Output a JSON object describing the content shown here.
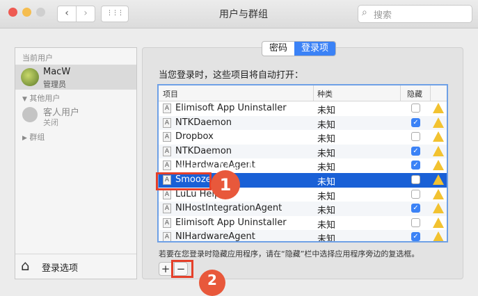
{
  "window": {
    "title": "用户与群组",
    "search_placeholder": "搜索",
    "nav_back": "‹",
    "nav_forward": "›",
    "grid": "⋮⋮⋮"
  },
  "colors": {
    "accent": "#1960d6",
    "close": "#ee5a52",
    "minimize": "#f5bd4f",
    "zoom": "#cfcfcf",
    "annotation": "#e5402a"
  },
  "sidebar": {
    "current_users_label": "当前用户",
    "current_user": {
      "name": "MacW",
      "role": "管理员"
    },
    "other_users_label": "其他用户",
    "guest_user": {
      "name": "客人用户",
      "status": "关闭"
    },
    "groups_label": "群组",
    "login_options": "登录选项"
  },
  "tabs": [
    {
      "label": "密码"
    },
    {
      "label": "登录项"
    }
  ],
  "heading": "当您登录时，这些项目将自动打开：",
  "table": {
    "headers": {
      "item": "项目",
      "kind": "种类",
      "hide": "隐藏"
    },
    "rows": [
      {
        "name": "Elimisoft App Uninstaller",
        "kind": "未知",
        "hidden": false
      },
      {
        "name": "NTKDaemon",
        "kind": "未知",
        "hidden": true
      },
      {
        "name": "Dropbox",
        "kind": "未知",
        "hidden": false
      },
      {
        "name": "NTKDaemon",
        "kind": "未知",
        "hidden": true
      },
      {
        "name": "NIHardwareAgent",
        "kind": "未知",
        "hidden": true
      },
      {
        "name": "Smooze",
        "kind": "未知",
        "hidden": false
      },
      {
        "name": "LuLu Helper",
        "kind": "未知",
        "hidden": false
      },
      {
        "name": "NIHostIntegrationAgent",
        "kind": "未知",
        "hidden": true
      },
      {
        "name": "Elimisoft App Uninstaller",
        "kind": "未知",
        "hidden": false
      },
      {
        "name": "NIHardwareAgent",
        "kind": "未知",
        "hidden": true
      }
    ]
  },
  "hint": "若要在您登录时隐藏应用程序，请在“隐藏”栏中选择应用程序旁边的复选框。",
  "buttons": {
    "add": "+",
    "remove": "−"
  },
  "annotations": {
    "step1": "1",
    "step2": "2"
  },
  "watermark": "www.MacW.com"
}
